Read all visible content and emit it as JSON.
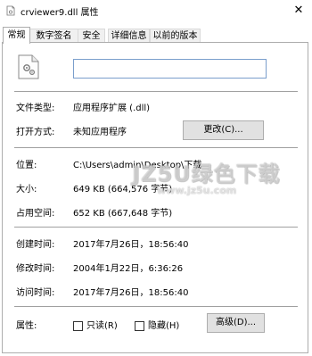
{
  "window": {
    "title": "crviewer9.dll 属性",
    "close_glyph": "✕"
  },
  "tabs": [
    {
      "label": "常规",
      "active": true
    },
    {
      "label": "数字签名",
      "active": false
    },
    {
      "label": "安全",
      "active": false
    },
    {
      "label": "详细信息",
      "active": false
    },
    {
      "label": "以前的版本",
      "active": false
    }
  ],
  "general": {
    "file_name": "",
    "file_type_label": "文件类型:",
    "file_type_value": "应用程序扩展 (.dll)",
    "opens_with_label": "打开方式:",
    "opens_with_value": "未知应用程序",
    "change_button": "更改(C)...",
    "location_label": "位置:",
    "location_value": "C:\\Users\\admin\\Desktop\\下载",
    "size_label": "大小:",
    "size_value": "649 KB (664,576 字节)",
    "size_on_disk_label": "占用空间:",
    "size_on_disk_value": "652 KB (667,648 字节)",
    "created_label": "创建时间:",
    "created_value": "2017年7月26日，18:56:40",
    "modified_label": "修改时间:",
    "modified_value": "2004年1月22日，6:36:26",
    "accessed_label": "访问时间:",
    "accessed_value": "2017年7月26日，18:56:40",
    "attributes_label": "属性:",
    "readonly_label": "只读(R)",
    "hidden_label": "隐藏(H)",
    "advanced_button": "高级(D)..."
  },
  "watermark": {
    "main": "JZ5U绿色下载",
    "sub": "www.jz5u.com"
  }
}
